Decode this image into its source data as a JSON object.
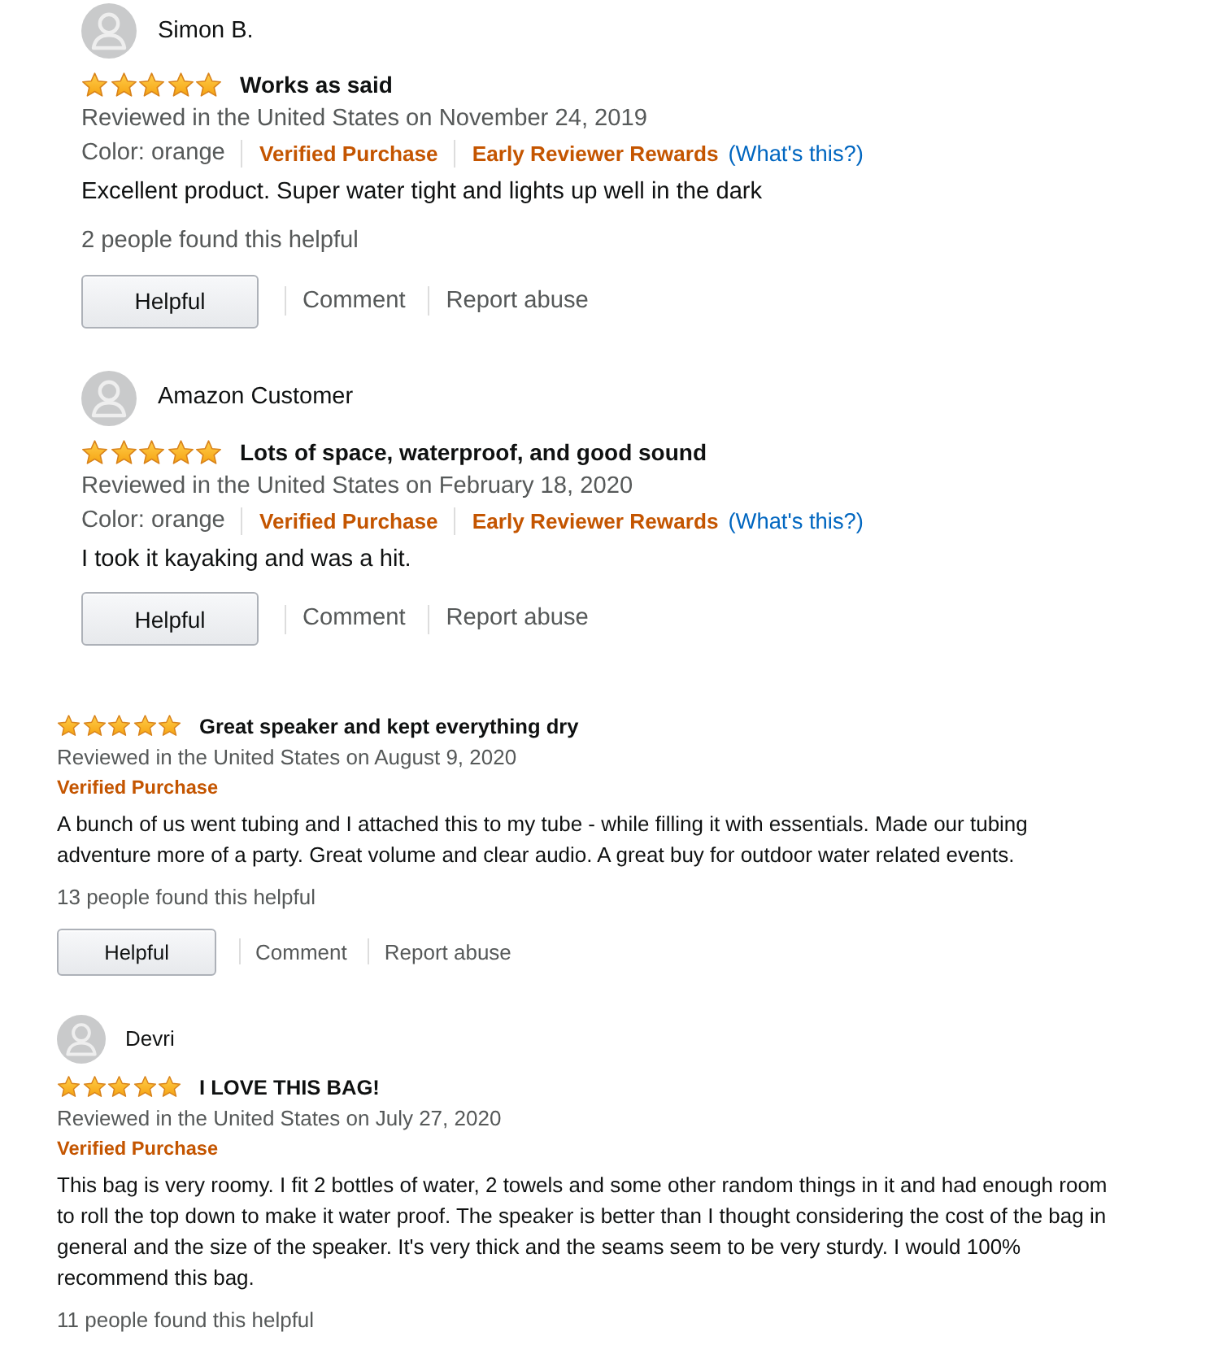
{
  "review_groups": [
    {
      "reviews": [
        {
          "reviewer": {
            "name": "Simon B."
          },
          "stars": 5,
          "title": "Works as said",
          "reviewed": "Reviewed in the United States on November 24, 2019",
          "badges": [
            {
              "kind": "variant",
              "text": "Color: orange"
            },
            {
              "kind": "verified",
              "text": "Verified Purchase"
            },
            {
              "kind": "program",
              "text": "Early Reviewer Rewards",
              "link": "(What's this?)"
            }
          ],
          "body": "Excellent product. Super water tight and lights up well in the dark",
          "helpful_count": "2 people found this helpful",
          "actions": [
            {
              "kind": "vote",
              "label": "Helpful"
            },
            {
              "kind": "comment",
              "label": "Comment"
            },
            {
              "kind": "report",
              "label": "Report abuse"
            }
          ]
        },
        {
          "reviewer": {
            "name": "Amazon Customer"
          },
          "stars": 5,
          "title": "Lots of space, waterproof, and good sound",
          "reviewed": "Reviewed in the United States on February 18, 2020",
          "badges": [
            {
              "kind": "variant",
              "text": "Color: orange"
            },
            {
              "kind": "verified",
              "text": "Verified Purchase"
            },
            {
              "kind": "program",
              "text": "Early Reviewer Rewards",
              "link": "(What's this?)"
            }
          ],
          "body": "I took it kayaking and was a hit.",
          "actions": [
            {
              "kind": "vote",
              "label": "Helpful"
            },
            {
              "kind": "comment",
              "label": "Comment"
            },
            {
              "kind": "report",
              "label": "Report abuse"
            }
          ]
        }
      ]
    },
    {
      "reviews": [
        {
          "stars": 5,
          "title": "Great speaker and kept everything dry",
          "reviewed": "Reviewed in the United States on August 9, 2020",
          "badges": [
            {
              "kind": "verified",
              "text": "Verified Purchase"
            }
          ],
          "body": "A bunch of us went tubing and I attached this to my tube - while filling it with essentials. Made our tubing adventure more of a party. Great volume and clear audio. A great buy for outdoor water related events.",
          "helpful_count": "13 people found this helpful",
          "actions": [
            {
              "kind": "vote",
              "label": "Helpful"
            },
            {
              "kind": "comment",
              "label": "Comment"
            },
            {
              "kind": "report",
              "label": "Report abuse"
            }
          ]
        },
        {
          "reviewer": {
            "name": "Devri"
          },
          "stars": 5,
          "title": "I LOVE THIS BAG!",
          "reviewed": "Reviewed in the United States on July 27, 2020",
          "badges": [
            {
              "kind": "verified",
              "text": "Verified Purchase"
            }
          ],
          "body": "This bag is very roomy. I fit 2 bottles of water, 2 towels and some other random things in it and had enough room to roll the top down to make it water proof. The speaker is better than I thought considering the cost of the bag in general and the size of the speaker. It's very thick and the seams seem to be very sturdy. I would 100% recommend this bag.",
          "helpful_count": "11 people found this helpful"
        }
      ]
    }
  ]
}
